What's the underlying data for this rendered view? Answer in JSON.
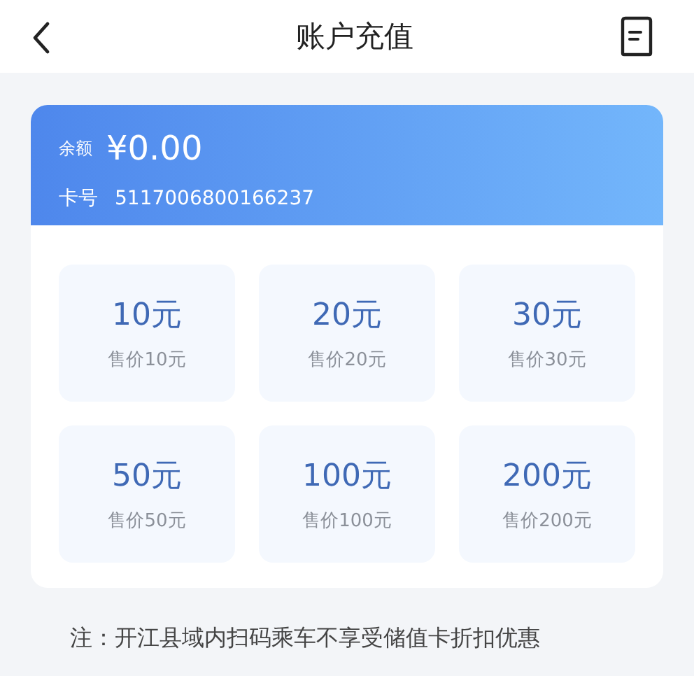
{
  "header": {
    "title": "账户充值"
  },
  "account": {
    "balance_label": "余额",
    "balance": "¥0.00",
    "card_label": "卡号",
    "card_number": "5117006800166237"
  },
  "options": [
    {
      "amount": "10元",
      "price": "售价10元"
    },
    {
      "amount": "20元",
      "price": "售价20元"
    },
    {
      "amount": "30元",
      "price": "售价30元"
    },
    {
      "amount": "50元",
      "price": "售价50元"
    },
    {
      "amount": "100元",
      "price": "售价100元"
    },
    {
      "amount": "200元",
      "price": "售价200元"
    }
  ],
  "note": "注：开江县域内扫码乘车不享受储值卡折扣优惠"
}
